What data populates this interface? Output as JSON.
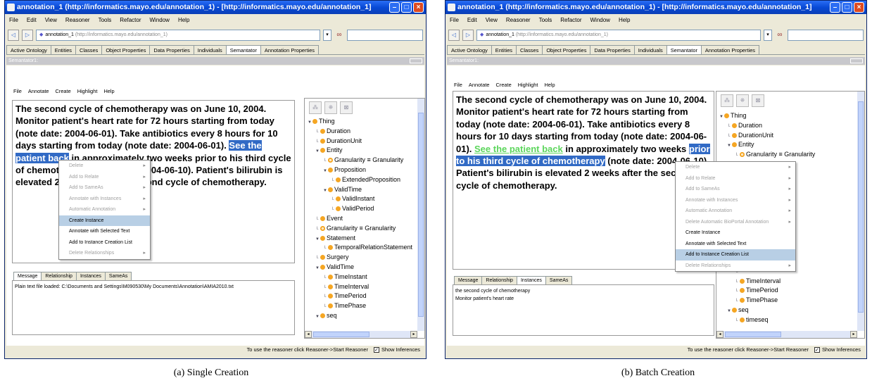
{
  "panels": [
    {
      "title": "annotation_1 (http://informatics.mayo.edu/annotation_1) - [http://informatics.mayo.edu/annotation_1]",
      "menu": [
        "File",
        "Edit",
        "View",
        "Reasoner",
        "Tools",
        "Refactor",
        "Window",
        "Help"
      ],
      "url_name": "annotation_1",
      "url_uri": "(http://informatics.mayo.edu/annotation_1)",
      "tabs": [
        "Active Ontology",
        "Entities",
        "Classes",
        "Object Properties",
        "Data Properties",
        "Individuals",
        "Semantator",
        "Annotation Properties"
      ],
      "active_tab": "Semantator",
      "sub_title": "Semantator1:",
      "sub_menu": [
        "File",
        "Annotate",
        "Create",
        "Highlight",
        "Help"
      ],
      "text_parts": [
        {
          "t": "The second cycle of chemotherapy was on June 10, 2004. Monitor patient's heart rate for 72 hours starting from today (note date: 2004-06-01). Take antibiotics every 8 hours for 10 days starting from today (note date: 2004-06-01). ",
          "s": ""
        },
        {
          "t": "See the patient back",
          "s": "sel"
        },
        {
          "t": " in approximately two weeks prior to his third cycle of chemotherapy (note date: 2004-06-10). Patient's bilirubin is elevated 2 weeks after the second cycle of chemotherapy.",
          "s": ""
        }
      ],
      "context_menu": [
        {
          "label": "Delete",
          "disabled": true,
          "sub": true
        },
        {
          "label": "Add to Relate",
          "disabled": true,
          "sub": true
        },
        {
          "label": "Add to SameAs",
          "disabled": true,
          "sub": true
        },
        {
          "label": "Annotate with Instances",
          "disabled": true,
          "sub": true
        },
        {
          "label": "Automatic Annotation",
          "disabled": true,
          "sub": true
        },
        {
          "label": "Create Instance",
          "disabled": false,
          "sub": false,
          "highlight": true
        },
        {
          "label": "Annotate with Selected Text",
          "disabled": false,
          "sub": false
        },
        {
          "label": "Add to Instance Creation List",
          "disabled": false,
          "sub": false
        },
        {
          "label": "Delete Relationships",
          "disabled": true,
          "sub": true
        }
      ],
      "lower_tabs": [
        "Message",
        "Relationship",
        "Instances",
        "SameAs"
      ],
      "lower_active": "Message",
      "messages": [
        "Plain text file loaded: C:\\Documents and Settings\\M090530\\My Documents\\Annotation\\AMIA2010.txt"
      ],
      "tree": [
        {
          "label": "Thing",
          "d": 0,
          "t": "open"
        },
        {
          "label": "Duration",
          "d": 1
        },
        {
          "label": "DurationUnit",
          "d": 1
        },
        {
          "label": "Entity",
          "d": 1,
          "t": "open"
        },
        {
          "label": "Granularity ≡ Granularity",
          "d": 2,
          "eq": true
        },
        {
          "label": "Proposition",
          "d": 2,
          "t": "open"
        },
        {
          "label": "ExtendedProposition",
          "d": 3
        },
        {
          "label": "ValidTime",
          "d": 2,
          "t": "open"
        },
        {
          "label": "ValidInstant",
          "d": 3
        },
        {
          "label": "ValidPeriod",
          "d": 3
        },
        {
          "label": "Event",
          "d": 1
        },
        {
          "label": "Granularity ≡ Granularity",
          "d": 1,
          "eq": true
        },
        {
          "label": "Statement",
          "d": 1,
          "t": "open"
        },
        {
          "label": "TemporalRelationStatement",
          "d": 2
        },
        {
          "label": "Surgery",
          "d": 1
        },
        {
          "label": "ValidTime",
          "d": 1,
          "t": "open"
        },
        {
          "label": "TimeInstant",
          "d": 2
        },
        {
          "label": "TimeInterval",
          "d": 2
        },
        {
          "label": "TimePeriod",
          "d": 2
        },
        {
          "label": "TimePhase",
          "d": 2
        },
        {
          "label": "seq",
          "d": 1,
          "t": "open"
        }
      ],
      "status": "To use the reasoner click Reasoner->Start Reasoner",
      "show_inferences": "Show Inferences",
      "caption": "(a)  Single Creation"
    },
    {
      "title": "annotation_1 (http://informatics.mayo.edu/annotation_1) - [http://informatics.mayo.edu/annotation_1]",
      "menu": [
        "File",
        "Edit",
        "View",
        "Reasoner",
        "Tools",
        "Refactor",
        "Window",
        "Help"
      ],
      "url_name": "annotation_1",
      "url_uri": "(http://informatics.mayo.edu/annotation_1)",
      "tabs": [
        "Active Ontology",
        "Entities",
        "Classes",
        "Object Properties",
        "Data Properties",
        "Individuals",
        "Semantator",
        "Annotation Properties"
      ],
      "active_tab": "Semantator",
      "sub_title": "Semantator1:",
      "sub_menu": [
        "File",
        "Annotate",
        "Create",
        "Highlight",
        "Help"
      ],
      "text_parts": [
        {
          "t": "The second cycle of chemotherapy was on June 10, 2004. Monitor patient's heart rate for 72 hours starting from today (note date: 2004-06-01). Take antibiotics every 8 hours for 10 days starting from today (note date: 2004-06-01). ",
          "s": ""
        },
        {
          "t": "See the patient back",
          "s": "link"
        },
        {
          "t": " in approximately two weeks ",
          "s": ""
        },
        {
          "t": "prior to his third cycle of chemotherapy",
          "s": "sel"
        },
        {
          "t": " (note date: 2004-06-10). Patient's bilirubin is elevated 2 weeks after the second cycle of chemotherapy.",
          "s": ""
        }
      ],
      "context_menu": [
        {
          "label": "Delete",
          "disabled": true,
          "sub": true
        },
        {
          "label": "Add to Relate",
          "disabled": true,
          "sub": true
        },
        {
          "label": "Add to SameAs",
          "disabled": true,
          "sub": true
        },
        {
          "label": "Annotate with Instances",
          "disabled": true,
          "sub": true
        },
        {
          "label": "Automatic Annotation",
          "disabled": true,
          "sub": true
        },
        {
          "label": "Delete Automatic BioPortal Annotation",
          "disabled": true,
          "sub": true
        },
        {
          "label": "Create Instance",
          "disabled": false,
          "sub": false
        },
        {
          "label": "Annotate with Selected Text",
          "disabled": false,
          "sub": false
        },
        {
          "label": "Add to Instance Creation List",
          "disabled": false,
          "sub": false,
          "highlight": true
        },
        {
          "label": "Delete Relationships",
          "disabled": true,
          "sub": true
        }
      ],
      "lower_tabs": [
        "Message",
        "Relationship",
        "Instances",
        "SameAs"
      ],
      "lower_active": "Instances",
      "messages": [
        "the second cycle of chemotherapy",
        "Monitor patient's heart rate"
      ],
      "tree": [
        {
          "label": "Thing",
          "d": 0,
          "t": "open"
        },
        {
          "label": "Duration",
          "d": 1
        },
        {
          "label": "DurationUnit",
          "d": 1
        },
        {
          "label": "Entity",
          "d": 1,
          "t": "open"
        },
        {
          "label": "Granularity ≡ Granularity",
          "d": 2,
          "eq": true
        },
        {
          "label": "Proposition",
          "d": 2,
          "t": "open"
        },
        {
          "label": "Proposition",
          "d": 3
        },
        {
          "label": "",
          "d": 3
        },
        {
          "label": "nt",
          "d": 3
        },
        {
          "label": "d",
          "d": 3
        },
        {
          "label": "",
          "d": 2
        },
        {
          "label": "anularity",
          "d": 2
        },
        {
          "label": "",
          "d": 2
        },
        {
          "label": "ationStatement",
          "d": 2
        },
        {
          "label": "",
          "d": 1
        },
        {
          "label": "",
          "d": 1
        },
        {
          "label": "",
          "d": 2
        },
        {
          "label": "TimeInterval",
          "d": 2
        },
        {
          "label": "TimePeriod",
          "d": 2
        },
        {
          "label": "TimePhase",
          "d": 2
        },
        {
          "label": "seq",
          "d": 1,
          "t": "open"
        },
        {
          "label": "timeseq",
          "d": 2
        }
      ],
      "status": "To use the reasoner click Reasoner->Start Reasoner",
      "show_inferences": "Show Inferences",
      "caption": "(b)  Batch Creation"
    }
  ],
  "colors": {
    "title": "#0849d6",
    "selection": "#316ac5",
    "link": "#5cd65c",
    "class_dot": "#f5a623"
  }
}
